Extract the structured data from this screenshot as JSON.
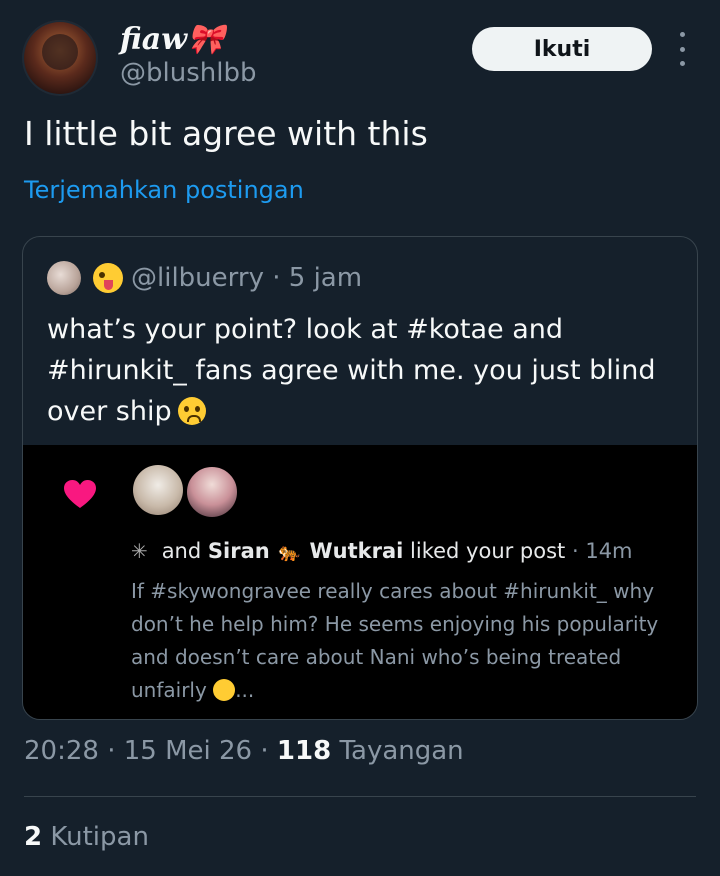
{
  "author": {
    "display_name": "fiaw🎀",
    "handle": "@blushlbb"
  },
  "follow_label": "Ikuti",
  "tweet": {
    "text": "I little bit agree with this",
    "translate_label": "Terjemahkan postingan"
  },
  "quoted": {
    "handle": "@lilbuerry",
    "separator": " · ",
    "time": "5 jam",
    "text": "what’s your point? look at #kotae and #hirunkit_ fans agree with me. you just blind over ship",
    "media": {
      "liked_prefix": "and",
      "liked_name1": "Siran",
      "liked_name2": "Wutkrai",
      "liked_suffix": "liked your post",
      "liked_time": "· 14m",
      "post_text": "If #skywongravee really cares about #hirunkit_ why don’t he help him? He seems enjoying his popularity and doesn’t care about Nani who’s being treated unfairly",
      "ellipsis": "...",
      "heart_color": "#f91880"
    }
  },
  "meta": {
    "time": "20:28",
    "dot": " · ",
    "date": "15 Mei 26",
    "views_count": "118",
    "views_label": "Tayangan"
  },
  "quotes": {
    "count": "2",
    "label": "Kutipan"
  },
  "icons": {
    "more": "more-vertical-icon",
    "heart": "heart-icon"
  }
}
